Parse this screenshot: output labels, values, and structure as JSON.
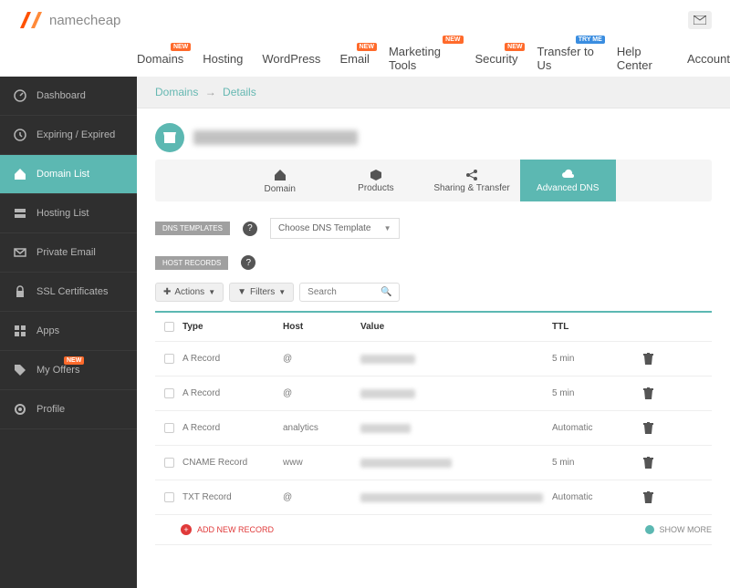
{
  "brand": {
    "name": "namecheap"
  },
  "topnav": [
    {
      "label": "Domains",
      "badge": "NEW"
    },
    {
      "label": "Hosting"
    },
    {
      "label": "WordPress"
    },
    {
      "label": "Email",
      "badge": "NEW"
    },
    {
      "label": "Marketing Tools",
      "badge": "NEW"
    },
    {
      "label": "Security",
      "badge": "NEW"
    },
    {
      "label": "Transfer to Us",
      "badge": "TRY ME",
      "badgeClass": "blue"
    },
    {
      "label": "Help Center"
    },
    {
      "label": "Account"
    }
  ],
  "sidebar": [
    {
      "label": "Dashboard",
      "icon": "gauge"
    },
    {
      "label": "Expiring / Expired",
      "icon": "clock"
    },
    {
      "label": "Domain List",
      "icon": "home",
      "active": true
    },
    {
      "label": "Hosting List",
      "icon": "server"
    },
    {
      "label": "Private Email",
      "icon": "mail"
    },
    {
      "label": "SSL Certificates",
      "icon": "lock"
    },
    {
      "label": "Apps",
      "icon": "apps"
    },
    {
      "label": "My Offers",
      "icon": "tag",
      "badge": "NEW"
    },
    {
      "label": "Profile",
      "icon": "gear"
    }
  ],
  "breadcrumb": {
    "parent": "Domains",
    "current": "Details"
  },
  "tabs": [
    {
      "label": "Domain",
      "icon": "home"
    },
    {
      "label": "Products",
      "icon": "box"
    },
    {
      "label": "Sharing & Transfer",
      "icon": "share"
    },
    {
      "label": "Advanced DNS",
      "icon": "cloud",
      "active": true
    }
  ],
  "dnsTemplates": {
    "label": "DNS TEMPLATES",
    "select": "Choose DNS Template"
  },
  "hostRecords": {
    "label": "HOST RECORDS",
    "actionsLabel": "Actions",
    "filtersLabel": "Filters",
    "searchPlaceholder": "Search",
    "columns": {
      "type": "Type",
      "host": "Host",
      "value": "Value",
      "ttl": "TTL"
    },
    "rows": [
      {
        "type": "A Record",
        "host": "@",
        "valueBlurW": 60,
        "ttl": "5 min"
      },
      {
        "type": "A Record",
        "host": "@",
        "valueBlurW": 60,
        "ttl": "5 min"
      },
      {
        "type": "A Record",
        "host": "analytics",
        "valueBlurW": 55,
        "ttl": "Automatic"
      },
      {
        "type": "CNAME Record",
        "host": "www",
        "valueBlurW": 100,
        "ttl": "5 min"
      },
      {
        "type": "TXT Record",
        "host": "@",
        "valueBlurW": 200,
        "ttl": "Automatic"
      }
    ],
    "addLabel": "ADD NEW RECORD",
    "showMoreLabel": "SHOW MORE"
  }
}
